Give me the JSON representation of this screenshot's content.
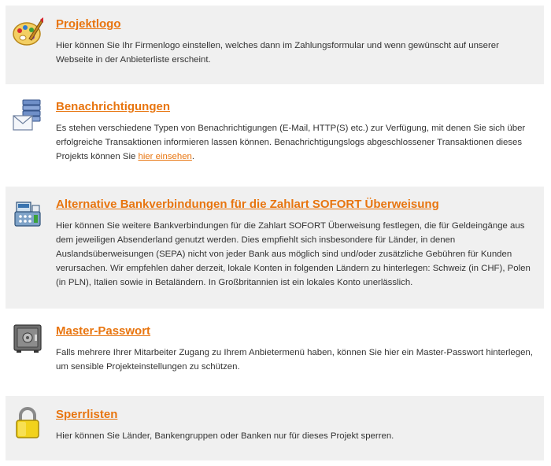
{
  "sections": [
    {
      "title": "Projektlogo",
      "icon": "palette-icon",
      "text": "Hier können Sie Ihr Firmenlogo einstellen, welches dann im Zahlungsformular und wenn gewünscht auf unserer Webseite in der Anbieterliste erscheint."
    },
    {
      "title": "Benachrichtigungen",
      "icon": "notification-icon",
      "text_before_link": "Es stehen verschiedene Typen von Benachrichtigungen (E-Mail, HTTP(S) etc.) zur Verfügung, mit denen Sie sich über erfolgreiche Transaktionen informieren lassen können. Benachrichtigungslogs abgeschlossener Transaktionen dieses Projekts können Sie ",
      "link_text": "hier einsehen",
      "text_after_link": "."
    },
    {
      "title": "Alternative Bankverbindungen für die Zahlart SOFORT Überweisung",
      "icon": "cash-register-icon",
      "text": "Hier können Sie weitere Bankverbindungen für die Zahlart SOFORT Überweisung festlegen, die für Geldeingänge aus dem jeweiligen Absenderland genutzt werden. Dies empfiehlt sich insbesondere für Länder, in denen Auslandsüberweisungen (SEPA) nicht von jeder Bank aus möglich sind und/oder zusätzliche Gebühren für Kunden verursachen. Wir empfehlen daher derzeit, lokale Konten in folgenden Ländern zu hinterlegen: Schweiz (in CHF), Polen (in PLN), Italien sowie in Betaländern. In Großbritannien ist ein lokales Konto unerlässlich."
    },
    {
      "title": "Master-Passwort",
      "icon": "safe-icon",
      "text": "Falls mehrere Ihrer Mitarbeiter Zugang zu Ihrem Anbietermenü haben, können Sie hier ein Master-Passwort hinterlegen, um sensible Projekteinstellungen zu schützen."
    },
    {
      "title": "Sperrlisten",
      "icon": "padlock-icon",
      "text": "Hier können Sie Länder, Bankengruppen oder Banken nur für dieses Projekt sperren."
    }
  ],
  "colors": {
    "title": "#e8750f",
    "shaded_background": "#f0f0f0",
    "text": "#333333"
  }
}
